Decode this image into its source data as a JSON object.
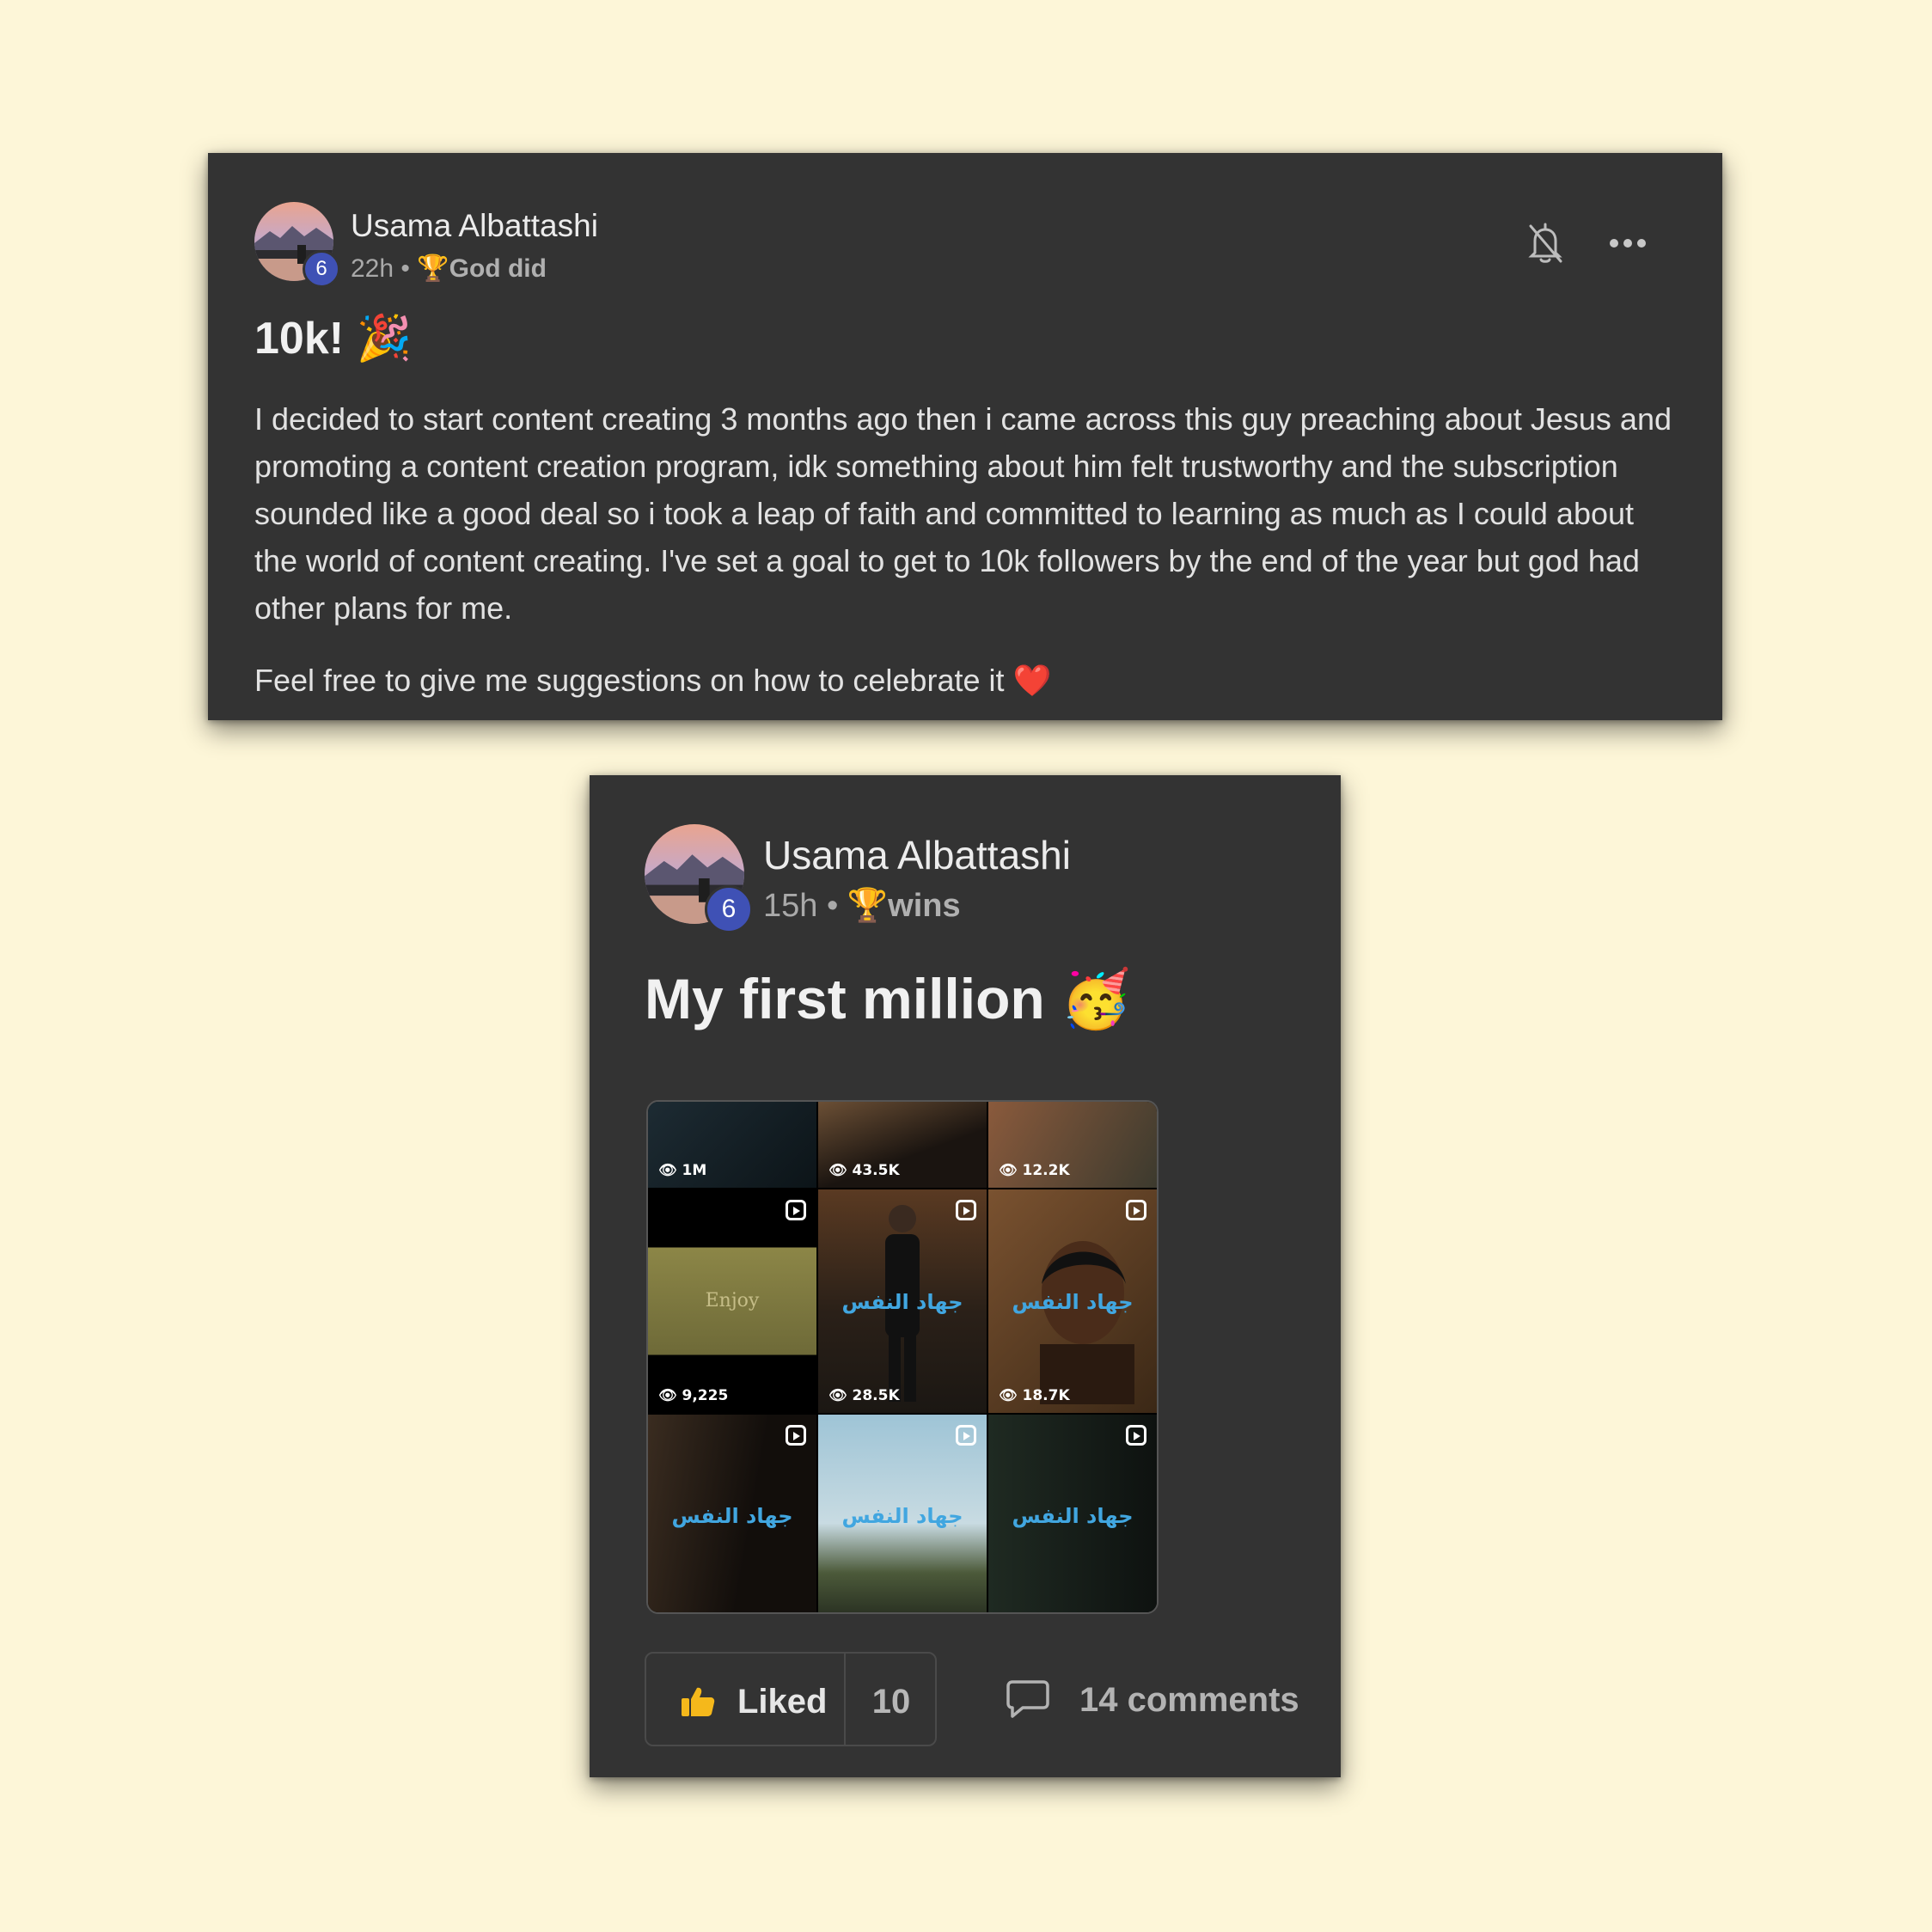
{
  "post1": {
    "author": "Usama Albattashi",
    "level": "6",
    "time": "22h",
    "separator": "•",
    "category_icon": "trophy-icon",
    "category": "God did",
    "title": "10k! 🎉",
    "body": "I decided to start content creating 3 months ago then i came across this guy preaching about Jesus and promoting a content creation program, idk something about him felt trustworthy and the subscription sounded like a good deal so i took a leap of faith and committed to learning as much as I could about the world of content creating. I've set a goal to get to 10k followers by the end of the year but god had other plans for me.",
    "body2": "Feel free to give me suggestions on how to celebrate it ❤️"
  },
  "post2": {
    "author": "Usama Albattashi",
    "level": "6",
    "time": "15h",
    "separator": "•",
    "category_icon": "trophy-icon",
    "category": "wins",
    "title": "My first million 🥳",
    "grid": {
      "views": [
        "1M",
        "43.5K",
        "12.2K",
        "9,225",
        "28.5K",
        "18.7K"
      ],
      "enjoy_text": "Enjoy",
      "arabic_title": "جهاد النفس"
    },
    "like_label": "Liked",
    "like_count": "10",
    "comments_label": "14 comments"
  },
  "colors": {
    "background": "#fdf6d8",
    "card": "#333333",
    "badge": "#3f51b5",
    "like_icon": "#f5b81b",
    "trophy": "#e8a317"
  }
}
